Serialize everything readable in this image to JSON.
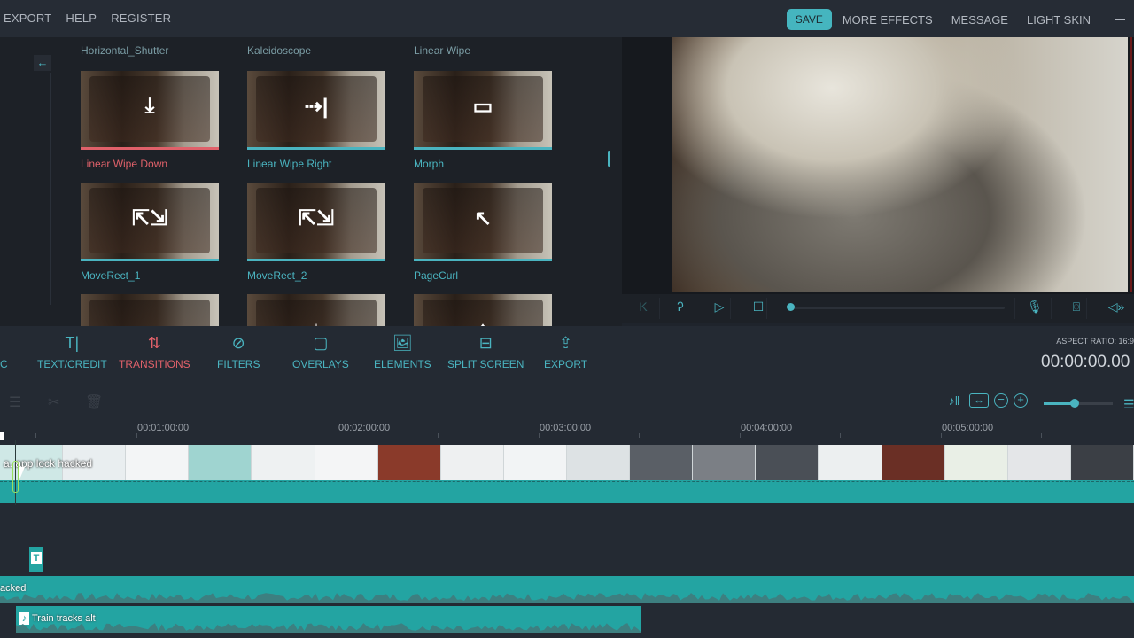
{
  "menubar": {
    "left": [
      "EXPORT",
      "HELP",
      "REGISTER"
    ],
    "save_label": "SAVE",
    "right": [
      "MORE EFFECTS",
      "MESSAGE",
      "LIGHT SKIN"
    ]
  },
  "effects_panel": {
    "back_icon": "arrow-left-icon",
    "partial_top_labels": [
      "Horizontal_Shutter",
      "Kaleidoscope",
      "Linear Wipe"
    ],
    "tiles": [
      {
        "label": "Linear Wipe Down",
        "glyph": "⤓",
        "active": true
      },
      {
        "label": "Linear Wipe Right",
        "glyph": "⇢|",
        "active": false
      },
      {
        "label": "Morph",
        "glyph": "▭",
        "active": false
      },
      {
        "label": "MoveRect_1",
        "glyph": "⇱⇲",
        "active": false
      },
      {
        "label": "MoveRect_2",
        "glyph": "⇱⇲",
        "active": false
      },
      {
        "label": "PageCurl",
        "glyph": "↖",
        "active": false
      },
      {
        "label": "",
        "glyph": "",
        "active": false
      },
      {
        "label": "",
        "glyph": "↓",
        "active": false
      },
      {
        "label": "",
        "glyph": "↑",
        "active": false
      }
    ]
  },
  "player": {
    "buttons": [
      "prev-frame",
      "next-frame",
      "play",
      "stop"
    ],
    "progress": 0,
    "right_buttons": [
      "microphone",
      "snapshot",
      "volume"
    ]
  },
  "toolbar": {
    "tools": [
      {
        "label": "C",
        "icon": ""
      },
      {
        "label": "TEXT/CREDIT",
        "icon": "T|"
      },
      {
        "label": "TRANSITIONS",
        "icon": "⇅",
        "active": true
      },
      {
        "label": "FILTERS",
        "icon": "⊘"
      },
      {
        "label": "OVERLAYS",
        "icon": "▢"
      },
      {
        "label": "ELEMENTS",
        "icon": "🖼"
      },
      {
        "label": "SPLIT SCREEN",
        "icon": "⊟"
      },
      {
        "label": "EXPORT",
        "icon": "⇪"
      }
    ],
    "aspect_ratio": "ASPECT RATIO: 16:9",
    "timecode": "00:00:00.00"
  },
  "timeline": {
    "edit_tools": [
      "adjust",
      "cut",
      "delete"
    ],
    "zoom_level": 0.45,
    "ruler": [
      "00:01:00:00",
      "00:02:00:00",
      "00:03:00:00",
      "00:04:00:00",
      "00:05:00:00"
    ],
    "video_clip_label": "a. app lock hacked",
    "text_clip_glyph": "T",
    "audio_clip_1_label": "acked",
    "audio_clip_2_label": "Train tracks alt",
    "note_glyph": "♪"
  },
  "colors": {
    "accent": "#4ab4c0",
    "active": "#e0616a",
    "track": "#23a4a2"
  }
}
